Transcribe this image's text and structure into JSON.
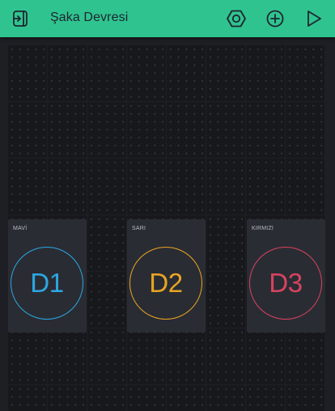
{
  "header": {
    "title": "Şaka Devresi",
    "background_color": "#2fc48f",
    "icons": [
      "exit-icon",
      "settings-hexagon-icon",
      "add-icon",
      "play-icon"
    ]
  },
  "widgets": [
    {
      "label": "MAVİ",
      "button_text": "D1",
      "color": "#2ba8e3"
    },
    {
      "label": "SARI",
      "button_text": "D2",
      "color": "#e8a523"
    },
    {
      "label": "KIRMIZI",
      "button_text": "D3",
      "color": "#d8435f"
    }
  ]
}
